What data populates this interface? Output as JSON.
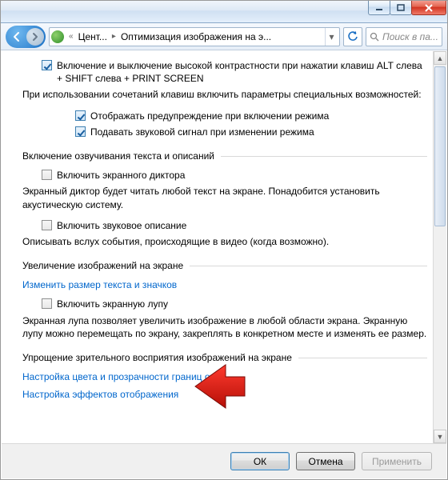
{
  "titlebar": {},
  "nav": {
    "crumb1": "Цент...",
    "crumb2": "Оптимизация изображения на э...",
    "search_placeholder": "Поиск в па..."
  },
  "top_section": {
    "chk_high_contrast_label": "Включение и выключение высокой контрастности при нажатии клавиш ALT слева + SHIFT слева + PRINT SCREEN",
    "sub_intro": "При использовании сочетаний клавиш включить параметры специальных возможностей:",
    "chk_show_warning_label": "Отображать предупреждение при включении режима",
    "chk_sound_label": "Подавать звуковой сигнал при изменении режима"
  },
  "section_narration": {
    "title": "Включение озвучивания текста и описаний",
    "chk_narrator_label": "Включить экранного диктора",
    "narrator_desc": "Экранный диктор будет читать любой текст на экране. Понадобится установить акустическую систему.",
    "chk_audio_desc_label": "Включить звуковое описание",
    "audio_desc_desc": "Описывать вслух события, происходящие в видео (когда возможно)."
  },
  "section_magnify": {
    "title": "Увеличение изображений на экране",
    "link_text_size": "Изменить размер текста и значков",
    "chk_magnifier_label": "Включить экранную лупу",
    "magnifier_desc": "Экранная лупа позволяет увеличить изображение в любой области экрана. Экранную лупу можно перемещать по экрану, закреплять в конкретном месте и изменять ее размер."
  },
  "section_simplify": {
    "title": "Упрощение зрительного восприятия изображений на экране",
    "link_color_border": "Настройка цвета и прозрачности границ окна",
    "link_effects": "Настройка эффектов отображения"
  },
  "footer": {
    "ok": "ОК",
    "cancel": "Отмена",
    "apply": "Применить"
  }
}
